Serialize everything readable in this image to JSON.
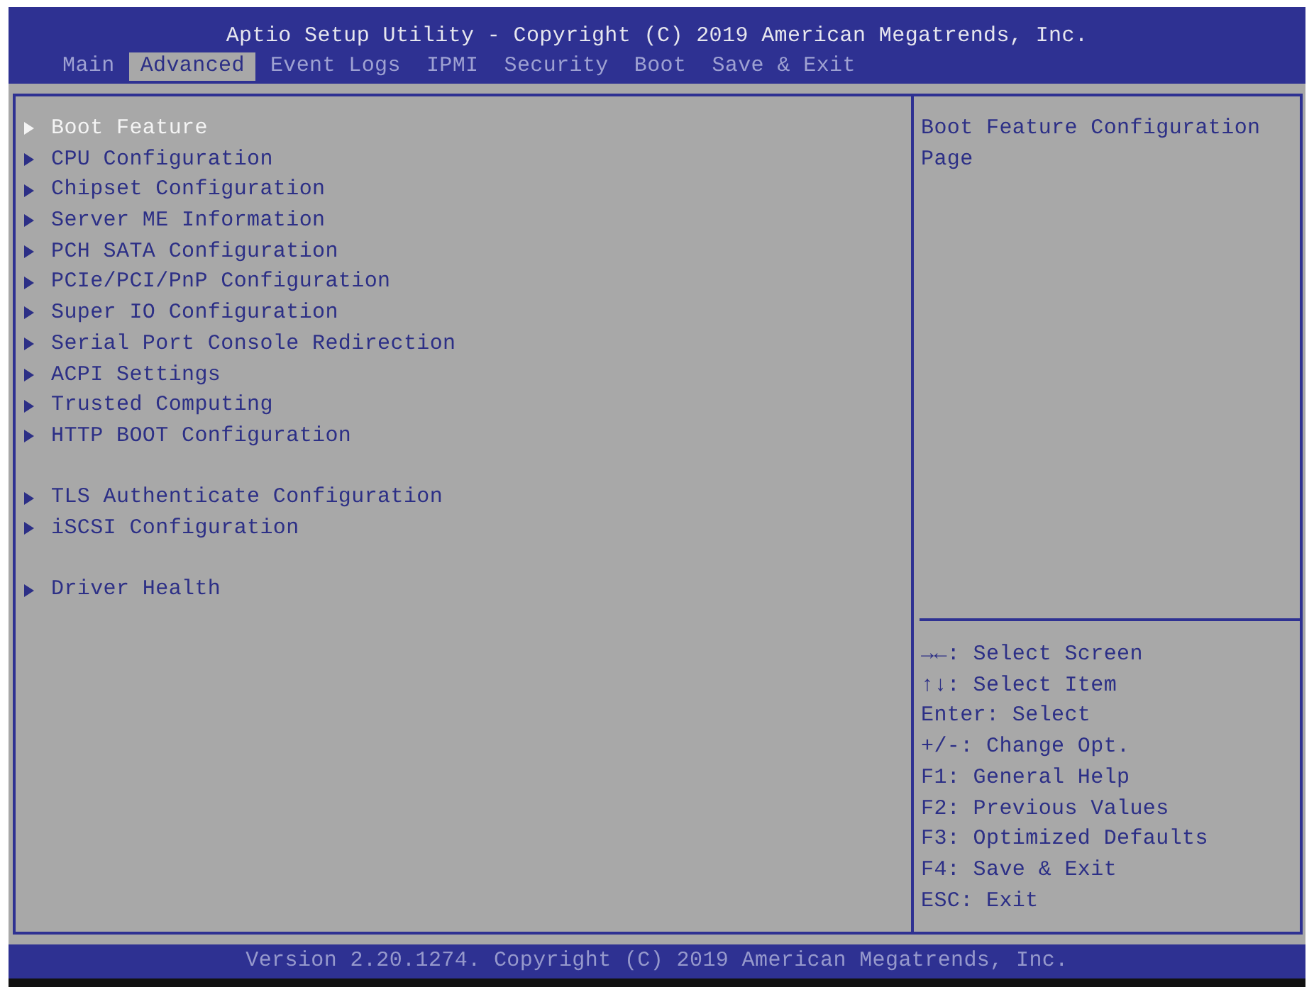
{
  "window": {
    "title": "Aptio Setup Utility - Copyright (C) 2019 American Megatrends, Inc."
  },
  "tabs": [
    {
      "label": "Main",
      "selected": false
    },
    {
      "label": "Advanced",
      "selected": true
    },
    {
      "label": "Event Logs",
      "selected": false
    },
    {
      "label": "IPMI",
      "selected": false
    },
    {
      "label": "Security",
      "selected": false
    },
    {
      "label": "Boot",
      "selected": false
    },
    {
      "label": "Save & Exit",
      "selected": false
    }
  ],
  "menu": {
    "groups": [
      {
        "items": [
          {
            "label": "Boot Feature",
            "selected": true
          },
          {
            "label": "CPU Configuration",
            "selected": false
          },
          {
            "label": "Chipset Configuration",
            "selected": false
          },
          {
            "label": "Server ME Information",
            "selected": false
          },
          {
            "label": "PCH SATA Configuration",
            "selected": false
          },
          {
            "label": "PCIe/PCI/PnP Configuration",
            "selected": false
          },
          {
            "label": "Super IO Configuration",
            "selected": false
          },
          {
            "label": "Serial Port Console Redirection",
            "selected": false
          },
          {
            "label": "ACPI Settings",
            "selected": false
          },
          {
            "label": "Trusted Computing",
            "selected": false
          },
          {
            "label": "HTTP BOOT Configuration",
            "selected": false
          }
        ]
      },
      {
        "items": [
          {
            "label": "TLS Authenticate Configuration",
            "selected": false
          },
          {
            "label": "iSCSI Configuration",
            "selected": false
          }
        ]
      },
      {
        "items": [
          {
            "label": "Driver Health",
            "selected": false
          }
        ]
      }
    ]
  },
  "help": {
    "description": "Boot Feature Configuration Page",
    "keys": [
      "→←: Select Screen",
      "↑↓: Select Item",
      "Enter: Select",
      "+/-: Change Opt.",
      "F1: General Help",
      "F2: Previous Values",
      "F3: Optimized Defaults",
      "F4: Save & Exit",
      "ESC: Exit"
    ]
  },
  "status_bar": {
    "text": "Version 2.20.1274. Copyright (C) 2019 American Megatrends, Inc."
  }
}
